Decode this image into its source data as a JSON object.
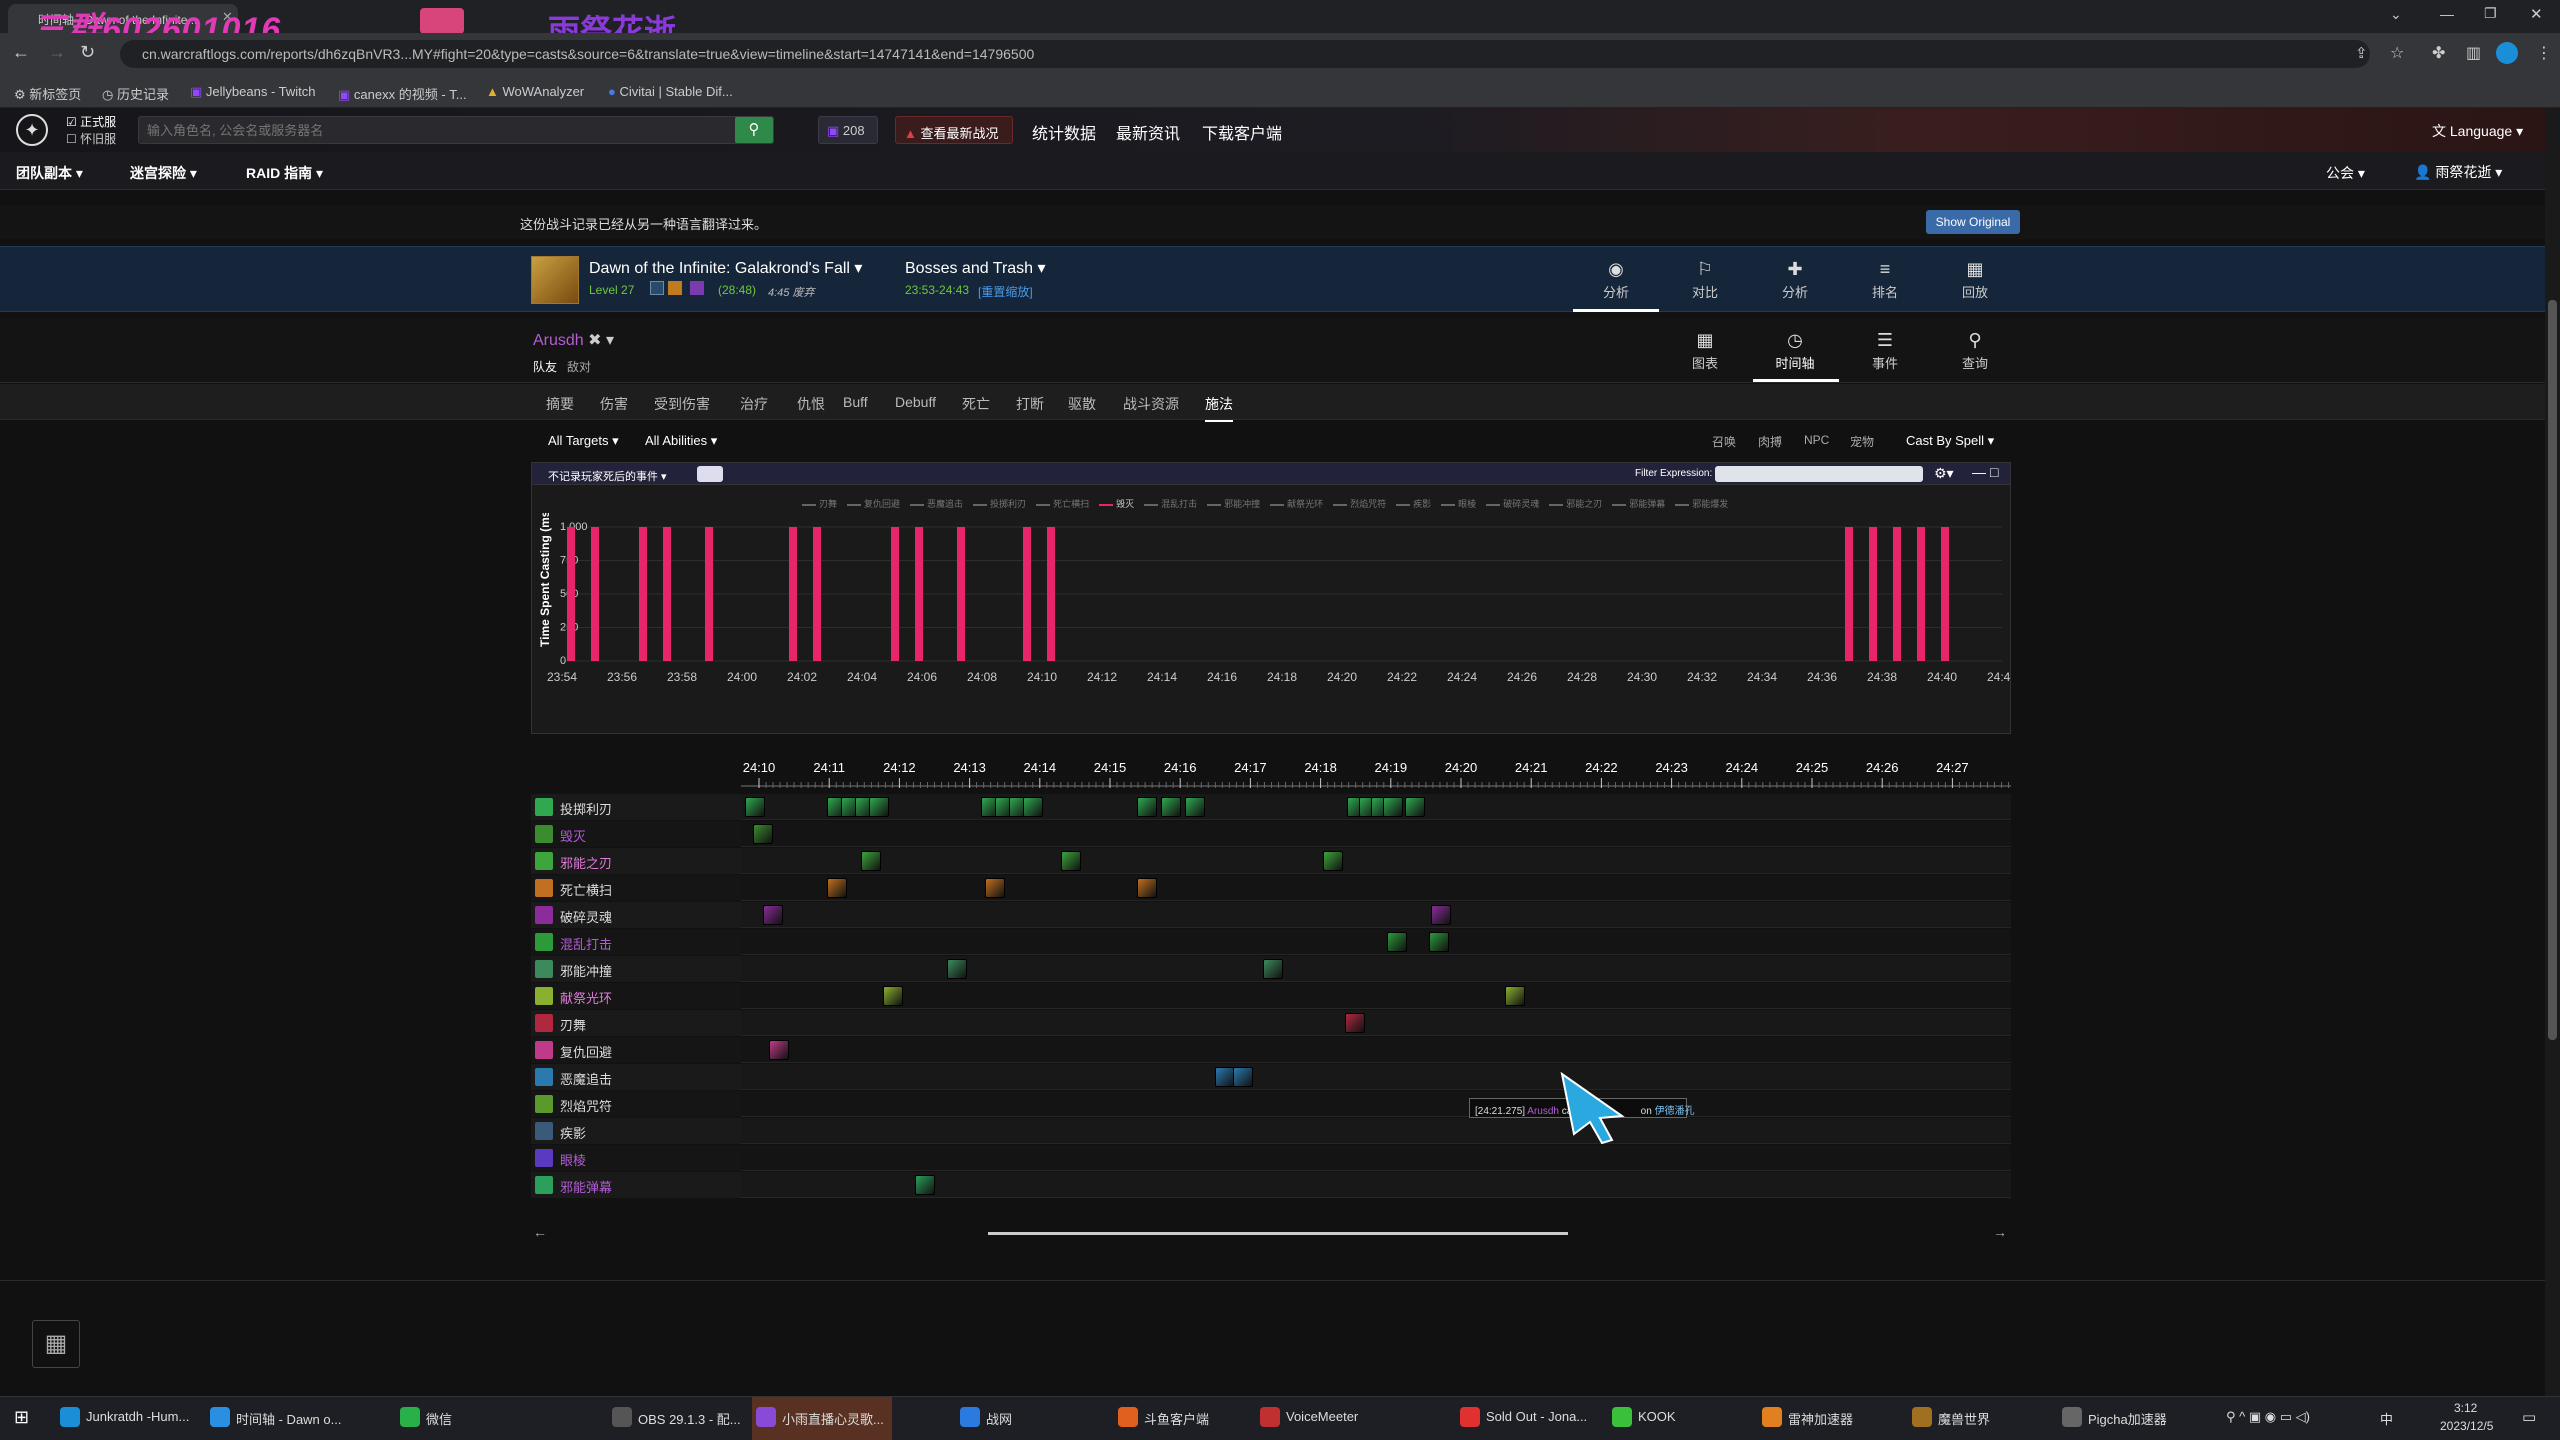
{
  "browser": {
    "tab_title": "时间轴 - Dawn of the Infinite...",
    "overlay_text": "三群602601016",
    "overlay_text2": "雨祭花逝",
    "url": "cn.warcraftlogs.com/reports/dh6zqBnVR3...MY#fight=20&type=casts&source=6&translate=true&view=timeline&start=14747141&end=14796500",
    "bookmarks": [
      "新标签页",
      "历史记录",
      "Jellybeans - Twitch",
      "canexx 的视频 - T...",
      "WoWAnalyzer",
      "Civitai | Stable Dif..."
    ]
  },
  "site": {
    "realm1": "正式服",
    "realm2": "怀旧服",
    "search_placeholder": "输入角色名, 公会名或服务器名",
    "twitch_count": "208",
    "latest_btn": "查看最新战况",
    "nav": [
      "统计数据",
      "最新资讯",
      "下载客户端"
    ],
    "language": "Language",
    "menu": [
      "团队副本",
      "迷宫探险",
      "RAID 指南"
    ],
    "guild": "公会",
    "user": "雨祭花逝"
  },
  "translation": {
    "notice": "这份战斗记录已经从另一种语言翻译过来。",
    "show_original": "Show Original"
  },
  "fight": {
    "name": "Dawn of the Infinite: Galakrond's Fall",
    "level": "Level 27",
    "duration": "(28:48)",
    "note": "4:45 废弃",
    "bosses": "Bosses and Trash",
    "time_range": "23:53-24:43",
    "reset_zoom": "[重置缩放]",
    "top_icons": [
      {
        "label": "分析",
        "glyph": "◉"
      },
      {
        "label": "对比",
        "glyph": "⚐"
      },
      {
        "label": "分析",
        "glyph": "✚"
      },
      {
        "label": "排名",
        "glyph": "≡"
      },
      {
        "label": "回放",
        "glyph": "▦"
      }
    ]
  },
  "player": {
    "name": "Arusdh",
    "team": "队友",
    "enemy": "敌对",
    "view_icons": [
      {
        "label": "图表",
        "glyph": "▦"
      },
      {
        "label": "时间轴",
        "glyph": "◷"
      },
      {
        "label": "事件",
        "glyph": "☰"
      },
      {
        "label": "查询",
        "glyph": "⚲"
      }
    ]
  },
  "subtabs": [
    "摘要",
    "伤害",
    "受到伤害",
    "治疗",
    "仇恨",
    "Buff",
    "Debuff",
    "死亡",
    "打断",
    "驱散",
    "战斗资源",
    "施法"
  ],
  "filters": {
    "targets": "All Targets",
    "abilities": "All Abilities",
    "right": [
      "召唤",
      "肉搏",
      "NPC",
      "宠物"
    ],
    "cast_by": "Cast By Spell"
  },
  "graph": {
    "events_filter": "不记录玩家死后的事件",
    "filter_expression": "Filter Expression:",
    "legend": [
      "刃舞",
      "复仇回避",
      "恶魔追击",
      "投掷利刃",
      "死亡横扫",
      "毁灭",
      "混乱打击",
      "邪能冲撞",
      "献祭光环",
      "烈焰咒符",
      "疾影",
      "眼棱",
      "破碎灵魂",
      "邪能之刃",
      "邪能弹幕",
      "邪能爆发"
    ]
  },
  "chart_data": {
    "type": "bar",
    "ylabel": "Time Spent Casting (ms)",
    "ylim": [
      0,
      1000
    ],
    "yticks": [
      "1,000",
      "750",
      "500",
      "250",
      "0"
    ],
    "xticks": [
      "23:54",
      "23:56",
      "23:58",
      "24:00",
      "24:02",
      "24:04",
      "24:06",
      "24:08",
      "24:10",
      "24:12",
      "24:14",
      "24:16",
      "24:18",
      "24:20",
      "24:22",
      "24:24",
      "24:26",
      "24:28",
      "24:30",
      "24:32",
      "24:34",
      "24:36",
      "24:38",
      "24:40",
      "24:42"
    ],
    "series": [
      {
        "name": "毁灭",
        "color": "#e8246a",
        "x": [
          "23:54.3",
          "23:55.1",
          "23:56.7",
          "23:57.5",
          "23:58.9",
          "24:01.7",
          "24:02.5",
          "24:05.1",
          "24:05.9",
          "24:07.3",
          "24:09.5",
          "24:10.3",
          "24:36.9",
          "24:37.7",
          "24:38.5",
          "24:39.3",
          "24:40.1"
        ],
        "values": [
          1000,
          1000,
          1000,
          1000,
          1000,
          1000,
          1000,
          1000,
          1000,
          1000,
          1000,
          1000,
          1000,
          1000,
          1000,
          1000,
          1000
        ]
      }
    ]
  },
  "timeline": {
    "ticks": [
      "24:10",
      "24:11",
      "24:12",
      "24:13",
      "24:14",
      "24:15",
      "24:16",
      "24:17",
      "24:18",
      "24:19",
      "24:20",
      "24:21",
      "24:22",
      "24:23",
      "24:24",
      "24:25",
      "24:26",
      "24:27"
    ],
    "rows": [
      {
        "name": "投掷利刃",
        "color": "#2fa84f",
        "text": "#ddd",
        "casts": [
          4,
          86,
          100,
          114,
          128,
          240,
          254,
          268,
          282,
          396,
          420,
          444,
          606,
          618,
          630,
          642,
          664
        ]
      },
      {
        "name": "毁灭",
        "color": "#3a8c2f",
        "text": "#b45cd6",
        "casts": [
          12
        ]
      },
      {
        "name": "邪能之刃",
        "color": "#3ca63c",
        "text": "#e07bd8",
        "casts": [
          120,
          320,
          582
        ]
      },
      {
        "name": "死亡横扫",
        "color": "#c07020",
        "text": "#ddd",
        "casts": [
          86,
          244,
          396
        ]
      },
      {
        "name": "破碎灵魂",
        "color": "#8a2c9a",
        "text": "#ddd",
        "casts": [
          22,
          690
        ]
      },
      {
        "name": "混乱打击",
        "color": "#2d9a3a",
        "text": "#b45cd6",
        "casts": [
          646,
          688
        ]
      },
      {
        "name": "邪能冲撞",
        "color": "#3c8a5c",
        "text": "#ddd",
        "casts": [
          206,
          522
        ]
      },
      {
        "name": "献祭光环",
        "color": "#8ab030",
        "text": "#e07bd8",
        "casts": [
          142,
          764
        ]
      },
      {
        "name": "刃舞",
        "color": "#b02840",
        "text": "#ddd",
        "casts": [
          604
        ]
      },
      {
        "name": "复仇回避",
        "color": "#c03a8a",
        "text": "#ddd",
        "casts": [
          28
        ]
      },
      {
        "name": "恶魔追击",
        "color": "#2a7ab0",
        "text": "#ddd",
        "casts": [
          474,
          492
        ]
      },
      {
        "name": "烈焰咒符",
        "color": "#5a9a2a",
        "text": "#ddd",
        "casts": []
      },
      {
        "name": "疾影",
        "color": "#3a5a7a",
        "text": "#ddd",
        "casts": []
      },
      {
        "name": "眼棱",
        "color": "#5a3ac0",
        "text": "#b45cd6",
        "casts": []
      },
      {
        "name": "邪能弹幕",
        "color": "#2aa05a",
        "text": "#b45cd6",
        "casts": [
          174
        ]
      }
    ],
    "tooltip_time": "[24:21.275]",
    "tooltip_player": "Arusdh",
    "tooltip_cast": "casts",
    "tooltip_on": "on",
    "tooltip_target": "伊德潘孔"
  },
  "taskbar": {
    "items": [
      "Junkratdh -Hum...",
      "时间轴 - Dawn o...",
      "微信",
      "OBS 29.1.3 - 配...",
      "小雨直播心灵歌...",
      "战网",
      "斗鱼客户端",
      "VoiceMeeter",
      "Sold Out - Jona...",
      "KOOK",
      "雷神加速器",
      "魔兽世界",
      "Pigcha加速器"
    ],
    "tray_lang": "中",
    "time": "3:12",
    "date": "2023/12/5"
  }
}
